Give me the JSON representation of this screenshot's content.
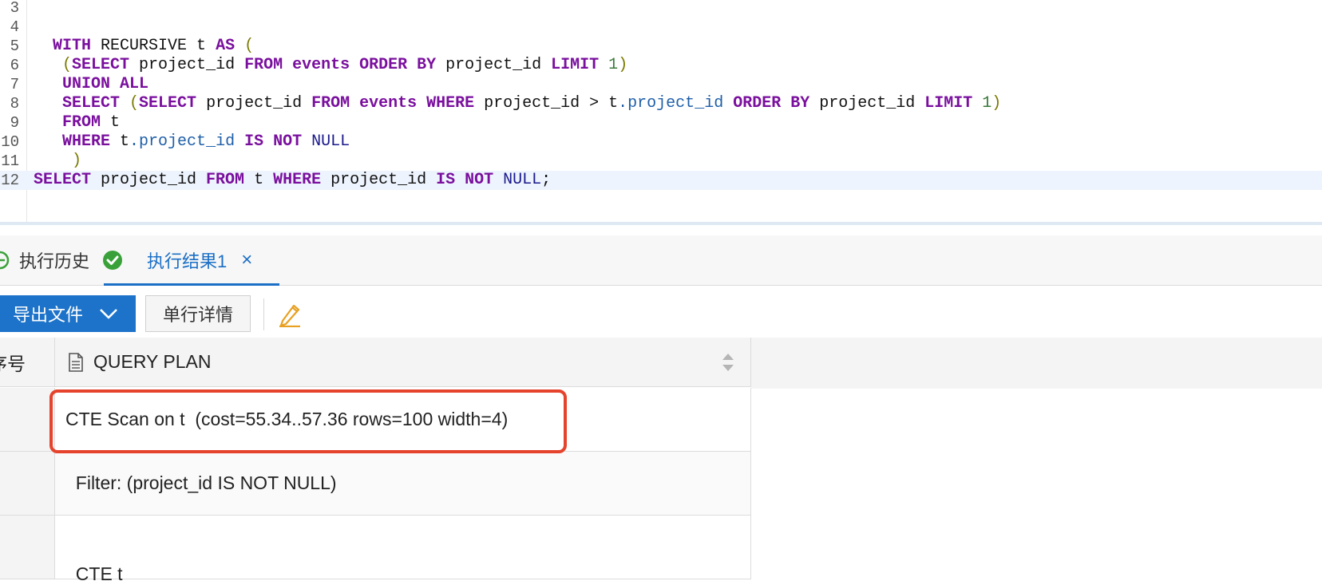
{
  "editor": {
    "lines": [
      {
        "n": "3",
        "parts": []
      },
      {
        "n": "4",
        "parts": []
      },
      {
        "n": "5",
        "parts": [
          [
            "",
            "  "
          ],
          [
            "kw",
            "WITH"
          ],
          [
            "",
            " RECURSIVE t "
          ],
          [
            "kw",
            "AS"
          ],
          [
            "par",
            " ("
          ]
        ]
      },
      {
        "n": "6",
        "parts": [
          [
            "",
            "   "
          ],
          [
            "par",
            "("
          ],
          [
            "kw",
            "SELECT"
          ],
          [
            "",
            " project_id "
          ],
          [
            "kw",
            "FROM"
          ],
          [
            "kw",
            " events "
          ],
          [
            "kw",
            "ORDER BY"
          ],
          [
            "",
            " project_id "
          ],
          [
            "kw",
            "LIMIT"
          ],
          [
            "num",
            " 1"
          ],
          [
            "par",
            ")"
          ]
        ]
      },
      {
        "n": "7",
        "parts": [
          [
            "",
            "   "
          ],
          [
            "kw",
            "UNION ALL"
          ]
        ]
      },
      {
        "n": "8",
        "parts": [
          [
            "",
            "   "
          ],
          [
            "kw",
            "SELECT"
          ],
          [
            "par",
            " ("
          ],
          [
            "kw",
            "SELECT"
          ],
          [
            "",
            " project_id "
          ],
          [
            "kw",
            "FROM"
          ],
          [
            "kw",
            " events "
          ],
          [
            "kw",
            "WHERE"
          ],
          [
            "",
            " project_id > t"
          ],
          [
            "col",
            ".project_id"
          ],
          [
            "kw",
            " ORDER BY"
          ],
          [
            "",
            " project_id "
          ],
          [
            "kw",
            "LIMIT"
          ],
          [
            "num",
            " 1"
          ],
          [
            "par",
            ")"
          ]
        ]
      },
      {
        "n": "9",
        "parts": [
          [
            "",
            "   "
          ],
          [
            "kw",
            "FROM"
          ],
          [
            "",
            " t"
          ]
        ]
      },
      {
        "n": "10",
        "parts": [
          [
            "",
            "   "
          ],
          [
            "kw",
            "WHERE"
          ],
          [
            "",
            " t"
          ],
          [
            "col",
            ".project_id"
          ],
          [
            "kw",
            " IS NOT"
          ],
          [
            "nul",
            " NULL"
          ]
        ]
      },
      {
        "n": "11",
        "parts": [
          [
            "",
            "    "
          ],
          [
            "par",
            ")"
          ]
        ]
      },
      {
        "n": "12",
        "parts": [
          [
            "kw",
            "SELECT"
          ],
          [
            "",
            " project_id "
          ],
          [
            "kw",
            "FROM"
          ],
          [
            "",
            " t "
          ],
          [
            "kw",
            "WHERE"
          ],
          [
            "",
            " project_id "
          ],
          [
            "kw",
            "IS NOT"
          ],
          [
            "nul",
            " NULL"
          ],
          [
            "",
            ";"
          ]
        ],
        "current": true
      }
    ]
  },
  "tabs": {
    "history_label": "执行历史",
    "result_label": "执行结果1",
    "close_glyph": "×"
  },
  "toolbar": {
    "export_label": "导出文件",
    "detail_label": "单行详情"
  },
  "grid": {
    "index_header": "序号",
    "column_header": "QUERY PLAN",
    "rows": [
      "CTE Scan on t  (cost=55.34..57.36 rows=100 width=4)",
      "  Filter: (project_id IS NOT NULL)",
      "  CTE t"
    ]
  },
  "colors": {
    "accent": "#1d73c9",
    "highlight": "#e5432c",
    "success": "#3aa13a",
    "keyword": "#7a0f9e"
  }
}
